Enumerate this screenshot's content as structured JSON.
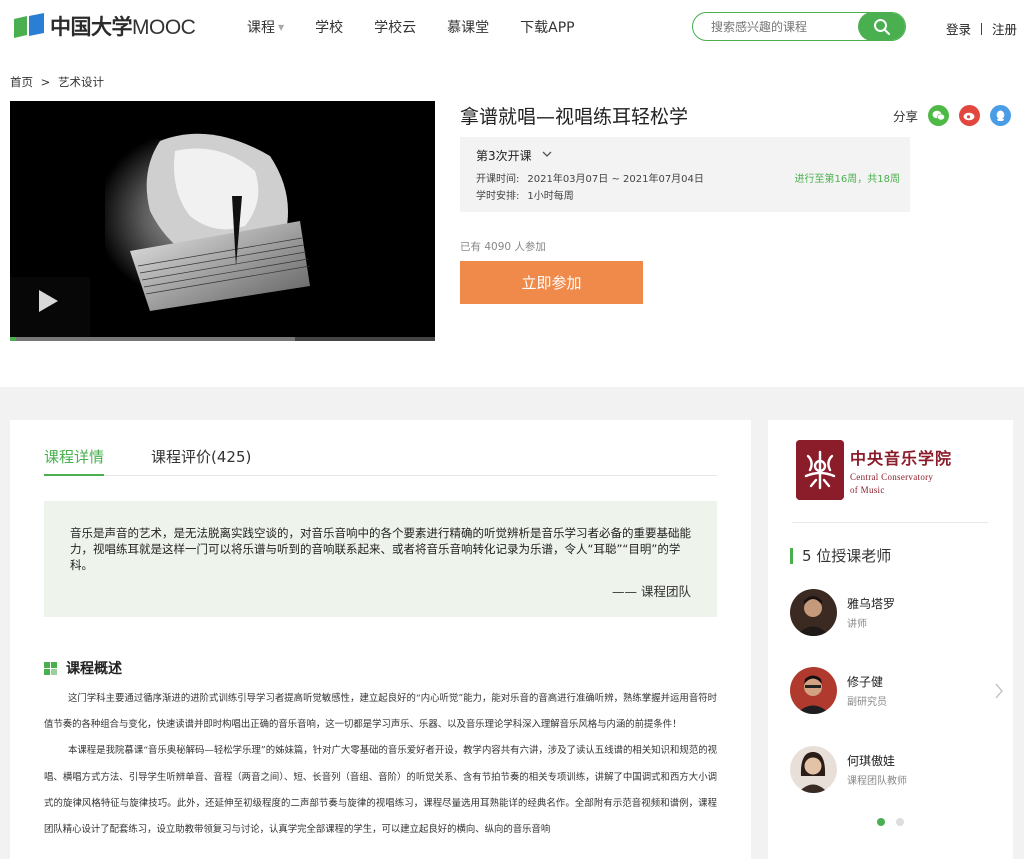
{
  "header": {
    "logo_text": "中国大学",
    "logo_text_latin": "MOOC",
    "nav": [
      "课程",
      "学校",
      "学校云",
      "慕课堂",
      "下载APP"
    ],
    "search_placeholder": "搜索感兴趣的课程",
    "login": "登录",
    "register": "注册"
  },
  "breadcrumb": [
    "首页",
    ">",
    "艺术设计"
  ],
  "course": {
    "title": "拿谱就唱—视唱练耳轻松学",
    "share_label": "分享",
    "session_label": "第3次开课",
    "time_label": "开课时间:",
    "time_value": "2021年03月07日 ~ 2021年07月04日",
    "schedule_label": "学时安排:",
    "schedule_value": "1小时每周",
    "progress_text": "进行至第16周，共18周",
    "joined_text": "已有 4090 人参加",
    "join_button": "立即参加",
    "video_progress": 0.67
  },
  "tabs": [
    "课程详情",
    "课程评价(425)"
  ],
  "quote": {
    "text": "音乐是声音的艺术，是无法脱离实践空谈的，对音乐音响中的各个要素进行精确的听觉辨析是音乐学习者必备的重要基础能力，视唱练耳就是这样一门可以将乐谱与听到的音响联系起来、或者将音乐音响转化记录为乐谱，令人“耳聪”“目明”的学科。",
    "author": "—— 课程团队"
  },
  "overview": {
    "heading": "课程概述",
    "para1": "这门学科主要通过循序渐进的进阶式训练引导学习者提高听觉敏感性，建立起良好的“内心听觉”能力，能对乐音的音高进行准确听辨，熟练掌握并运用音符时值节奏的各种组合与变化，快速读谱并即时构唱出正确的音乐音响，这一切都是学习声乐、乐器、以及音乐理论学科深入理解音乐风格与内涵的前提条件！",
    "para2": "本课程是我院慕课“音乐奥秘解码—轻松学乐理”的姊妹篇，针对广大零基础的音乐爱好者开设，教学内容共有六讲，涉及了读认五线谱的相关知识和规范的视唱、横唱方式方法、引导学生听辨单音、音程（两音之间）、短、长音列（音组、音阶）的听觉关系、含有节拍节奏的相关专项训练，讲解了中国调式和西方大小调式的旋律风格特征与旋律技巧。此外，还延伸至初级程度的二声部节奏与旋律的视唱练习，课程尽量选用耳熟能详的经典名作。全部附有示范音视频和谱例，课程团队精心设计了配套练习，设立助教带领复习与讨论，认真学完全部课程的学生，可以建立起良好的横向、纵向的音乐音响"
  },
  "school": {
    "name_cn": "中央音乐学院",
    "name_en_1": "Central Conservatory",
    "name_en_2": "of Music"
  },
  "teachers": {
    "heading": "5 位授课老师",
    "list": [
      {
        "name": "雅乌塔罗",
        "role": "讲师"
      },
      {
        "name": "修子健",
        "role": "副研究员"
      },
      {
        "name": "何琪傲娃",
        "role": "课程团队教师"
      }
    ]
  },
  "colors": {
    "brand_green": "#49af4f",
    "join_orange": "#f08a4b",
    "school_red": "#8b1d2a"
  }
}
